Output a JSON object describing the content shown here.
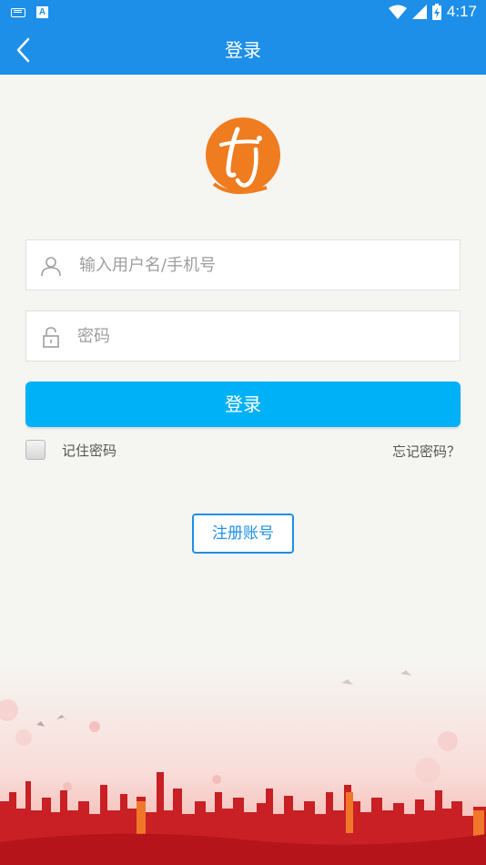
{
  "status_bar": {
    "time": "4:17",
    "app_icon_letter": "A"
  },
  "app_bar": {
    "title": "登录"
  },
  "login_form": {
    "username_placeholder": "输入用户名/手机号",
    "password_placeholder": "密码",
    "login_label": "登录",
    "remember_label": "记住密码",
    "remember_checked": false,
    "forgot_label": "忘记密码？"
  },
  "register": {
    "label": "注册账号"
  },
  "colors": {
    "primary": "#1e8fe8",
    "login_button": "#01b1f8",
    "logo_orange": "#ef7c1f",
    "background": "#f5f5f2"
  },
  "icons": {
    "back": "chevron-left-icon",
    "username": "user-icon",
    "password": "lock-icon",
    "logo": "tj-logo"
  }
}
